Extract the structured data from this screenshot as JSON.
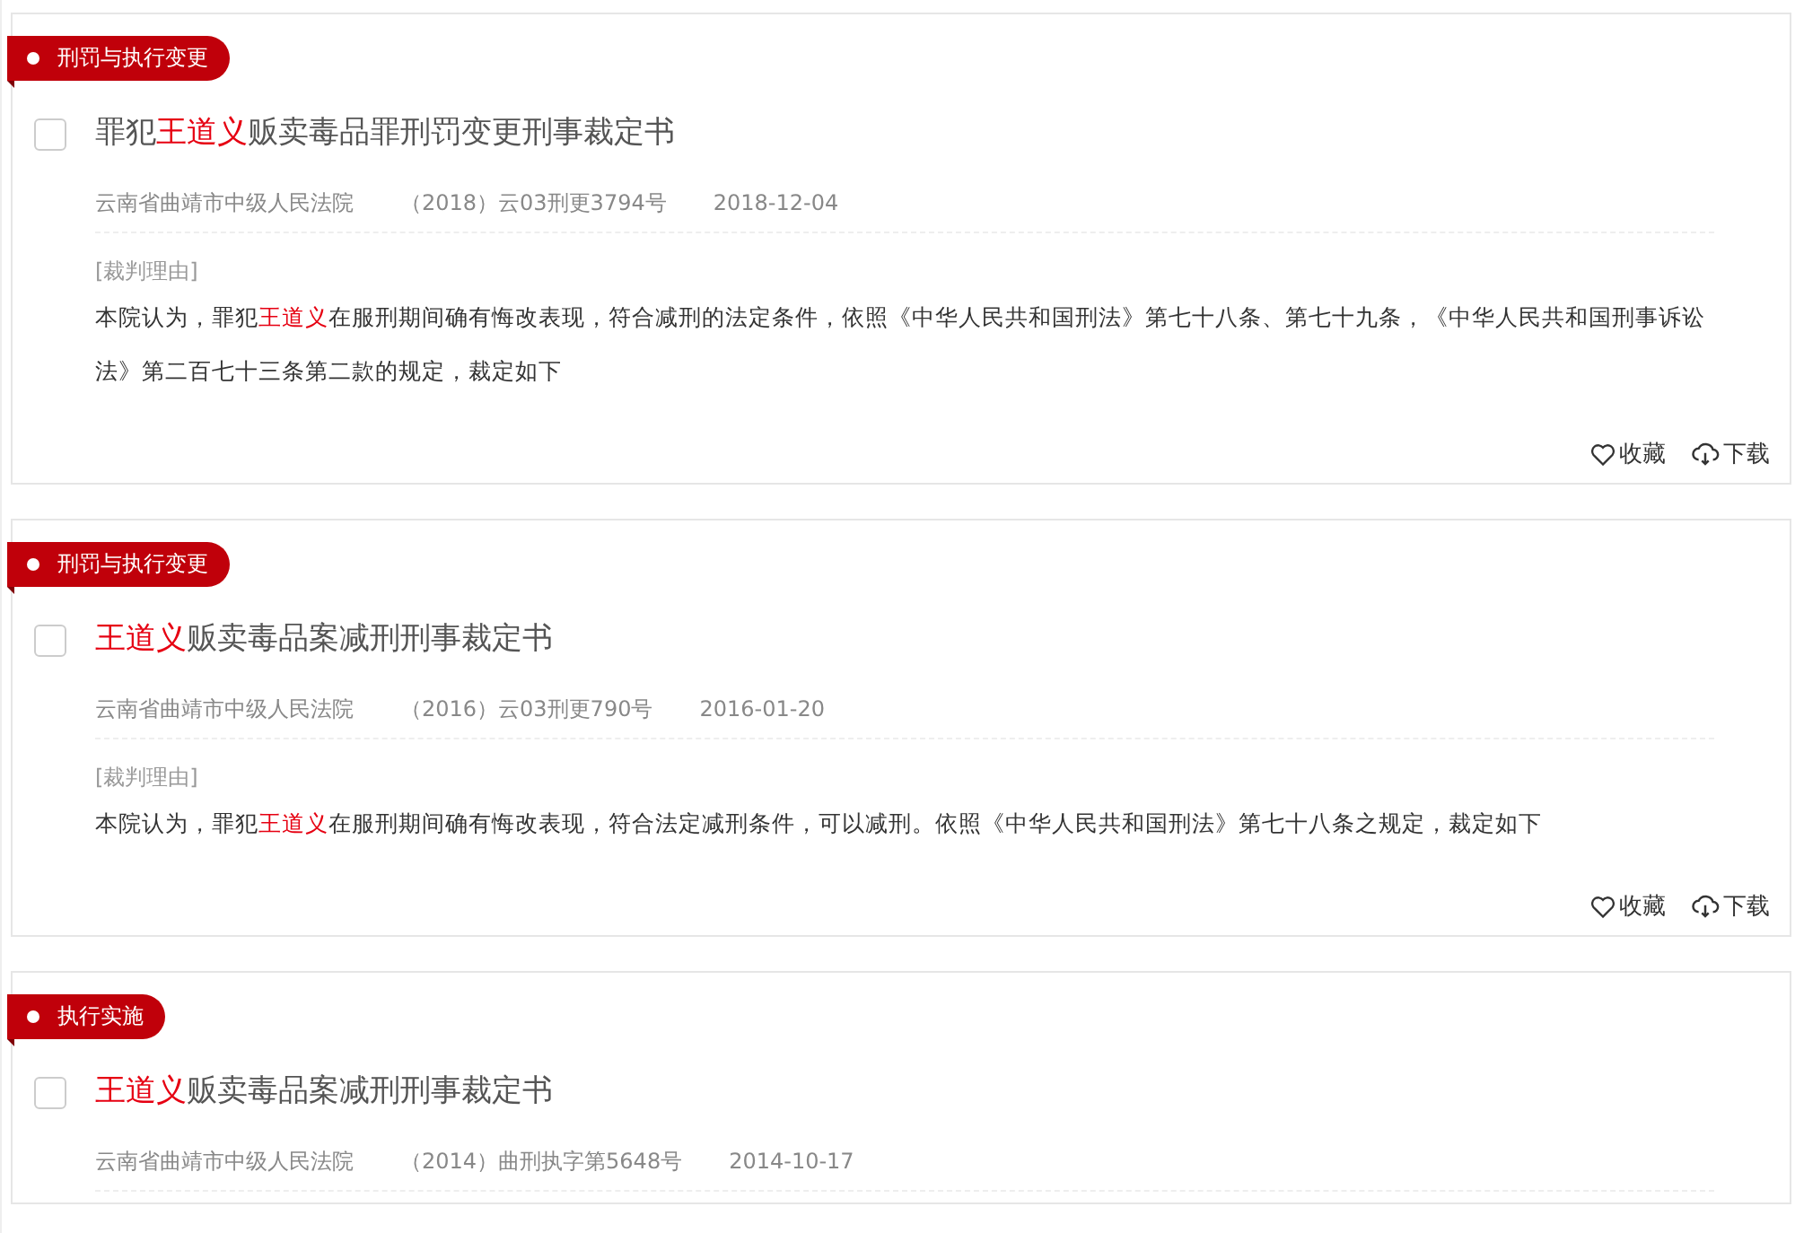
{
  "results": [
    {
      "category": "刑罚与执行变更",
      "selected": false,
      "title": [
        {
          "text": "罪犯",
          "highlight": false
        },
        {
          "text": "王道义",
          "highlight": true
        },
        {
          "text": "贩卖毒品罪刑罚变更刑事裁定书",
          "highlight": false
        }
      ],
      "court": "云南省曲靖市中级人民法院",
      "case_number": "（2018）云03刑更3794号",
      "date": "2018-12-04",
      "reason_label": "[裁判理由]",
      "reason": [
        {
          "text": "本院认为，罪犯",
          "highlight": false
        },
        {
          "text": "王道义",
          "highlight": true
        },
        {
          "text": "在服刑期间确有悔改表现，符合减刑的法定条件，依照《中华人民共和国刑法》第七十八条、第七十九条，《中华人民共和国刑事诉讼法》第二百七十三条第二款的规定，裁定如下",
          "highlight": false
        }
      ],
      "actions": [
        "收藏",
        "下载"
      ]
    },
    {
      "category": "刑罚与执行变更",
      "selected": false,
      "title": [
        {
          "text": "王道义",
          "highlight": true
        },
        {
          "text": "贩卖毒品案减刑刑事裁定书",
          "highlight": false
        }
      ],
      "court": "云南省曲靖市中级人民法院",
      "case_number": "（2016）云03刑更790号",
      "date": "2016-01-20",
      "reason_label": "[裁判理由]",
      "reason": [
        {
          "text": "本院认为，罪犯",
          "highlight": false
        },
        {
          "text": "王道义",
          "highlight": true
        },
        {
          "text": "在服刑期间确有悔改表现，符合法定减刑条件，可以减刑。依照《中华人民共和国刑法》第七十八条之规定，裁定如下",
          "highlight": false
        }
      ],
      "actions": [
        "收藏",
        "下载"
      ]
    },
    {
      "category": "执行实施",
      "selected": false,
      "title": [
        {
          "text": "王道义",
          "highlight": true
        },
        {
          "text": "贩卖毒品案减刑刑事裁定书",
          "highlight": false
        }
      ],
      "court": "云南省曲靖市中级人民法院",
      "case_number": "（2014）曲刑执字第5648号",
      "date": "2014-10-17"
    }
  ]
}
